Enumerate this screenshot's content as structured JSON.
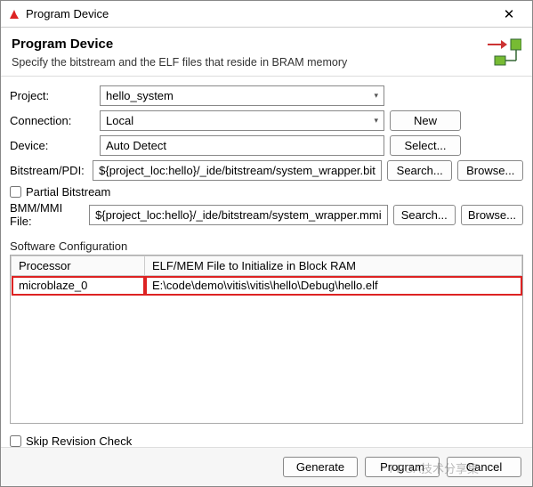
{
  "titlebar": {
    "title": "Program Device"
  },
  "header": {
    "title": "Program Device",
    "subtitle": "Specify the bitstream and the ELF files that reside in BRAM memory"
  },
  "form": {
    "project_label": "Project:",
    "project_value": "hello_system",
    "connection_label": "Connection:",
    "connection_value": "Local",
    "new_btn": "New",
    "device_label": "Device:",
    "device_value": "Auto Detect",
    "select_btn": "Select...",
    "bitstream_label": "Bitstream/PDI:",
    "bitstream_value": "${project_loc:hello}/_ide/bitstream/system_wrapper.bit",
    "search_btn": "Search...",
    "browse_btn": "Browse...",
    "partial_label": "Partial Bitstream",
    "bmm_label": "BMM/MMI File:",
    "bmm_value": "${project_loc:hello}/_ide/bitstream/system_wrapper.mmi"
  },
  "software": {
    "section_label": "Software Configuration",
    "col_processor": "Processor",
    "col_elf": "ELF/MEM File to Initialize in Block RAM",
    "rows": [
      {
        "proc": "microblaze_0",
        "elf": "E:\\code\\demo\\vitis\\vitis\\hello\\Debug\\hello.elf"
      }
    ]
  },
  "skip_label": "Skip Revision Check",
  "footer": {
    "generate": "Generate",
    "program": "Program",
    "cancel": "Cancel"
  },
  "watermark": "FPGA技术分享集"
}
